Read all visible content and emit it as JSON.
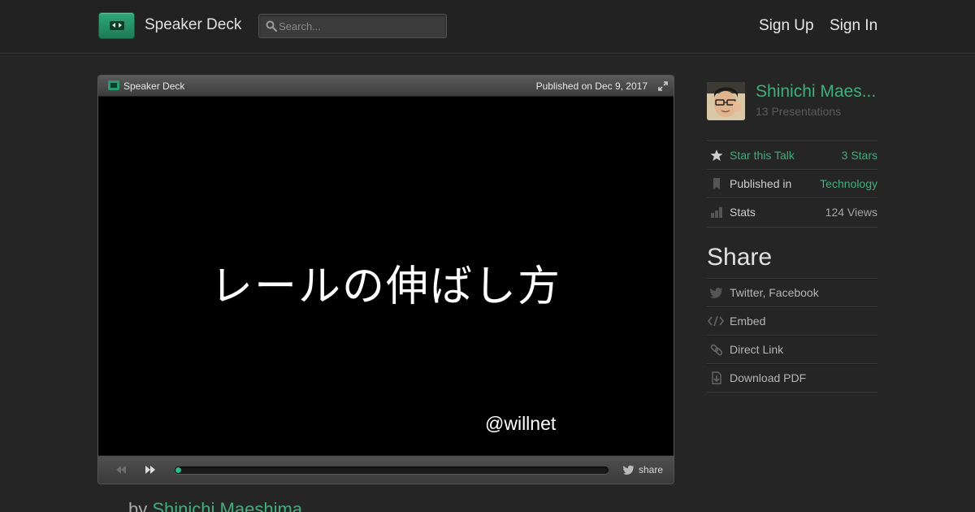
{
  "header": {
    "brand": "Speaker Deck",
    "search_placeholder": "Search...",
    "sign_up": "Sign Up",
    "sign_in": "Sign In"
  },
  "player": {
    "brand": "Speaker Deck",
    "published": "Published on Dec 9, 2017",
    "slide_title": "レールの伸ばし方",
    "slide_author": "@willnet",
    "progress_fraction": 0.01,
    "share_label": "share"
  },
  "byline": {
    "prefix": "by",
    "author": "Shinichi Maeshima"
  },
  "sidebar": {
    "author_name": "Shinichi Maes...",
    "presentations": "13 Presentations",
    "star_label": "Star this Talk",
    "star_count": "3 Stars",
    "published_label": "Published in",
    "category": "Technology",
    "stats_label": "Stats",
    "views": "124 Views",
    "share_heading": "Share",
    "share_social": "Twitter, Facebook",
    "embed": "Embed",
    "direct_link": "Direct Link",
    "download_pdf": "Download PDF"
  },
  "colors": {
    "accent": "#3fae7d",
    "background": "#252525",
    "muted_text": "#5b5b5b"
  }
}
